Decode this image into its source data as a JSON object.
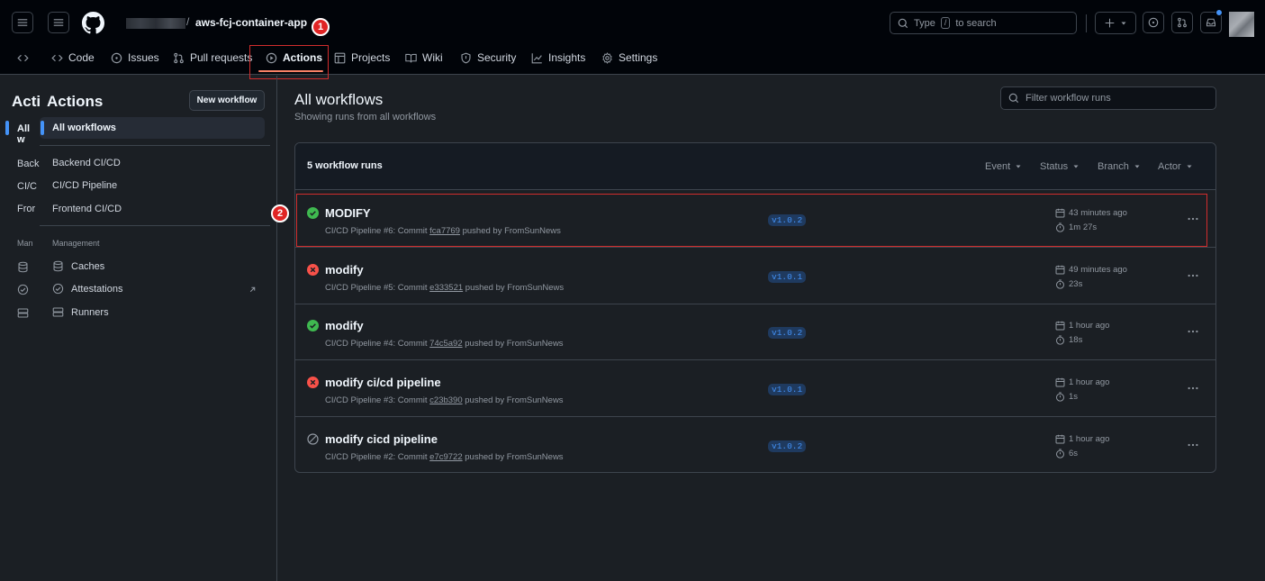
{
  "header": {
    "repo_name": "aws-fcj-container-app",
    "slash": "/",
    "search_placeholder_before": "Type",
    "search_key": "/",
    "search_placeholder_after": "to search"
  },
  "tabs": [
    {
      "label": "Code",
      "icon": "code-icon"
    },
    {
      "label": "Issues",
      "icon": "issue-icon"
    },
    {
      "label": "Pull requests",
      "icon": "pull-request-icon"
    },
    {
      "label": "Actions",
      "icon": "play-icon"
    },
    {
      "label": "Projects",
      "icon": "table-icon"
    },
    {
      "label": "Wiki",
      "icon": "book-icon"
    },
    {
      "label": "Security",
      "icon": "shield-icon"
    },
    {
      "label": "Insights",
      "icon": "graph-icon"
    },
    {
      "label": "Settings",
      "icon": "gear-icon"
    }
  ],
  "annotations": {
    "one": "1",
    "two": "2"
  },
  "collapsed_sidebar": {
    "title": "Acti",
    "active": "All w",
    "items": [
      "Back",
      "CI/C",
      "Fror"
    ],
    "section": "Man"
  },
  "sidebar": {
    "title": "Actions",
    "new_workflow": "New workflow",
    "all_workflows": "All workflows",
    "workflows": [
      "Backend CI/CD",
      "CI/CD Pipeline",
      "Frontend CI/CD"
    ],
    "management_label": "Management",
    "management": [
      {
        "label": "Caches",
        "icon": "database-icon"
      },
      {
        "label": "Attestations",
        "icon": "verified-icon"
      },
      {
        "label": "Runners",
        "icon": "server-icon"
      }
    ]
  },
  "main": {
    "title": "All workflows",
    "subtitle": "Showing runs from all workflows",
    "filter_placeholder": "Filter workflow runs",
    "runs_count": "5 workflow runs",
    "filters": [
      "Event",
      "Status",
      "Branch",
      "Actor"
    ],
    "runs": [
      {
        "title": "MODIFY",
        "status": "success",
        "workflow": "CI/CD Pipeline #6: Commit",
        "sha": "fca7769",
        "pushed_by": "pushed by FromSunNews",
        "branch": "v1.0.2",
        "when": "43 minutes ago",
        "duration": "1m 27s"
      },
      {
        "title": "modify",
        "status": "failure",
        "workflow": "CI/CD Pipeline #5: Commit",
        "sha": "e333521",
        "pushed_by": "pushed by FromSunNews",
        "branch": "v1.0.1",
        "when": "49 minutes ago",
        "duration": "23s"
      },
      {
        "title": "modify",
        "status": "success",
        "workflow": "CI/CD Pipeline #4: Commit",
        "sha": "74c5a92",
        "pushed_by": "pushed by FromSunNews",
        "branch": "v1.0.2",
        "when": "1 hour ago",
        "duration": "18s"
      },
      {
        "title": "modify ci/cd pipeline",
        "status": "failure",
        "workflow": "CI/CD Pipeline #3: Commit",
        "sha": "c23b390",
        "pushed_by": "pushed by FromSunNews",
        "branch": "v1.0.1",
        "when": "1 hour ago",
        "duration": "1s"
      },
      {
        "title": "modify cicd pipeline",
        "status": "cancelled",
        "workflow": "CI/CD Pipeline #2: Commit",
        "sha": "e7c9722",
        "pushed_by": "pushed by FromSunNews",
        "branch": "v1.0.2",
        "when": "1 hour ago",
        "duration": "6s"
      }
    ]
  },
  "colors": {
    "success": "#3fb950",
    "failure": "#f85149",
    "cancelled": "#9198a1",
    "accent": "#4493f8",
    "annotation": "#e02424"
  }
}
